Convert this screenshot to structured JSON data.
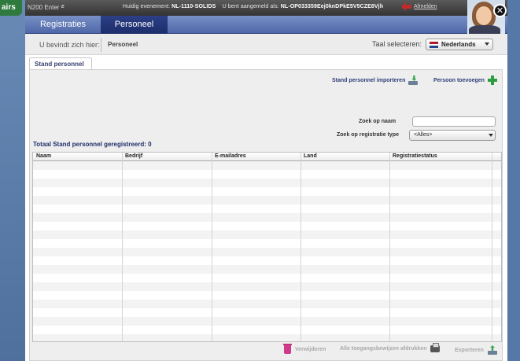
{
  "topbar": {
    "brand_name": "N200 Enter",
    "brand_mark": "ᴱ",
    "event_label": "Huidig evenement:",
    "event_code": "NL-1110-SOLIDS",
    "login_label": "U bent aangemeld als:",
    "login_id": "NL-OP033359Eej0knDPkE5V5CZE8Vjh",
    "logout_label": "Afmelden",
    "close_label": "✕"
  },
  "left_logo": "airs",
  "nav": {
    "tabs": [
      {
        "label": "Registraties",
        "active": false
      },
      {
        "label": "Personeel",
        "active": true
      }
    ]
  },
  "breadcrumb": {
    "label": "U bevindt zich hier:",
    "current": "Personeel"
  },
  "language": {
    "label": "Taal selecteren:",
    "selected": "Nederlands"
  },
  "content_tab": "Stand personnel",
  "actions": {
    "import_label": "Stand personnel importeren",
    "add_label": "Persoon toevoegen"
  },
  "search": {
    "name_label": "Zoek op naam",
    "name_value": "",
    "type_label": "Zoek op registratie type",
    "type_selected": "<Alles>"
  },
  "total_text": "Totaal Stand personnel geregistreerd: 0",
  "table": {
    "columns": [
      "Naam",
      "Bedrijf",
      "E-mailadres",
      "Land",
      "Registratiestatus"
    ],
    "rows": []
  },
  "bottom_actions": {
    "delete_label": "Verwijderen",
    "print_label": "Alle toegangsbewijzen afdrukken",
    "export_label": "Exporteren"
  },
  "colors": {
    "nav_active": "#1d2d6b",
    "nav_bar": "#5b73b0",
    "accent_text": "#2d3e7a",
    "logout_icon": "#c52a2a",
    "plus_icon": "#2e9d3e"
  }
}
